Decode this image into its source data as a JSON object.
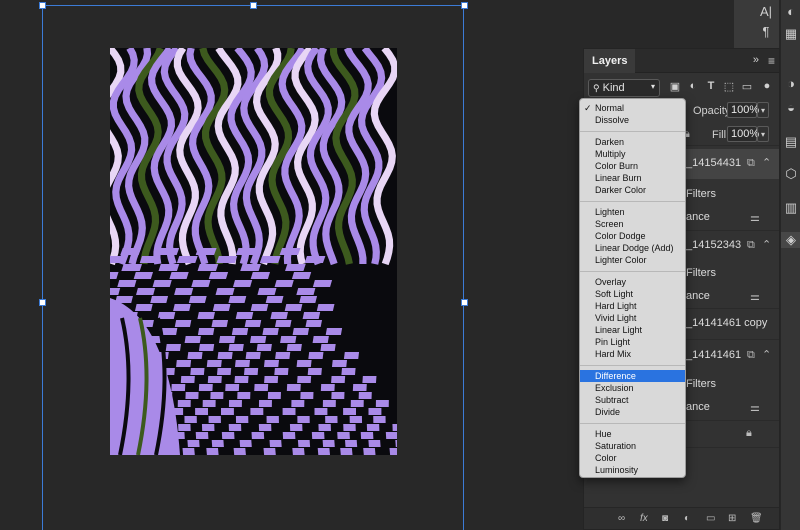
{
  "colors": {
    "accent": "#2a73e0",
    "selection_frame": "#3c7bd6",
    "artwork_purple": "#a98ae8",
    "artwork_green": "#3d5a1e",
    "artwork_black": "#0a0a0e"
  },
  "dock": {
    "character_icon": "A|",
    "paragraph_icon": "¶"
  },
  "layers_panel": {
    "tab_label": "Layers",
    "collapse_label": "»",
    "menu_icon": "≡",
    "filter": {
      "kind_label": "Kind",
      "search_icon": "search-icon",
      "icons": [
        "image-filter-icon",
        "adjustment-filter-icon",
        "type-filter-icon",
        "shape-filter-icon",
        "smart-object-filter-icon",
        "toggle-filter-icon"
      ]
    },
    "opacity_label": "Opacity:",
    "opacity_value": "100%",
    "fill_label": "Fill:",
    "fill_value": "100%",
    "layers": [
      {
        "name": "_14154431",
        "selected": true
      },
      {
        "name": "Filters"
      },
      {
        "name": "ance"
      },
      {
        "name": "_14152343"
      },
      {
        "name": "Filters"
      },
      {
        "name": "ance"
      },
      {
        "name": "_14141461 copy"
      },
      {
        "name": "_14141461"
      },
      {
        "name": "Filters"
      },
      {
        "name": "ance"
      }
    ],
    "footer_icons": [
      "link-icon",
      "fx-icon",
      "mask-icon",
      "adjustment-icon",
      "group-icon",
      "new-layer-icon",
      "trash-icon"
    ]
  },
  "blend_menu": {
    "selected": "Normal",
    "highlighted": "Difference",
    "groups": [
      [
        "Normal",
        "Dissolve"
      ],
      [
        "Darken",
        "Multiply",
        "Color Burn",
        "Linear Burn",
        "Darker Color"
      ],
      [
        "Lighten",
        "Screen",
        "Color Dodge",
        "Linear Dodge (Add)",
        "Lighter Color"
      ],
      [
        "Overlay",
        "Soft Light",
        "Hard Light",
        "Vivid Light",
        "Linear Light",
        "Pin Light",
        "Hard Mix"
      ],
      [
        "Difference",
        "Exclusion",
        "Subtract",
        "Divide"
      ],
      [
        "Hue",
        "Saturation",
        "Color",
        "Luminosity"
      ]
    ]
  }
}
